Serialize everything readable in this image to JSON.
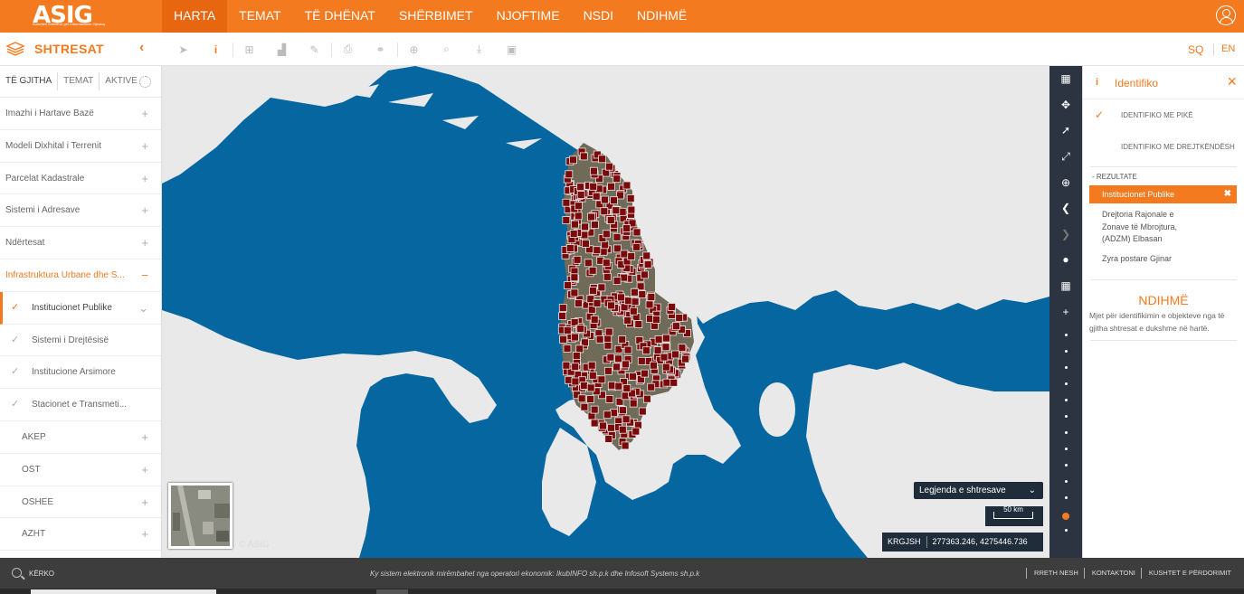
{
  "app": {
    "logo": "ASIG",
    "logo_subtitle": "Autoriteti Shtetëror për Informacionin Gjeohapësinor",
    "accent_color": "#f47a20",
    "nav": [
      "HARTA",
      "TEMAT",
      "TË DHËNAT",
      "SHËRBIMET",
      "NJOFTIME",
      "NSDI",
      "NDIHMË"
    ],
    "active_nav": "HARTA",
    "user_icon": "user-circle-icon"
  },
  "subbar": {
    "layers_title": "SHTRESAT",
    "collapse": "‹",
    "tools": [
      {
        "name": "select-pointer-icon",
        "glyph": "➤"
      },
      {
        "name": "identify-info-icon",
        "glyph": "i",
        "active": true
      },
      {
        "name": "zoom-box-icon",
        "glyph": "⊞"
      },
      {
        "name": "profile-chart-icon",
        "glyph": "▟"
      },
      {
        "name": "edit-icon",
        "glyph": "✎"
      },
      {
        "name": "print-icon",
        "glyph": "⎙"
      },
      {
        "name": "link-icon",
        "glyph": "⚭"
      },
      {
        "name": "add-icon",
        "glyph": "⊕"
      },
      {
        "name": "search-map-icon",
        "glyph": "⌕"
      },
      {
        "name": "download-icon",
        "glyph": "⤓"
      },
      {
        "name": "image-icon",
        "glyph": "▣"
      }
    ],
    "lang_sq": "SQ",
    "lang_en": "EN"
  },
  "sidebar": {
    "tabs": [
      "TË GJITHA",
      "TEMAT",
      "AKTIVE"
    ],
    "groups": [
      {
        "label": "Imazhi i Hartave Bazë",
        "toggle": "+"
      },
      {
        "label": "Modeli Dixhital i Terrenit",
        "toggle": "+"
      },
      {
        "label": "Parcelat Kadastrale",
        "toggle": "+"
      },
      {
        "label": "Sistemi i Adresave",
        "toggle": "+"
      },
      {
        "label": "Ndërtesat",
        "toggle": "+"
      },
      {
        "label": "Infrastruktura Urbane dhe S...",
        "toggle": "−"
      }
    ],
    "sublayers": [
      {
        "label": "Institucionet Publike",
        "toggle": "⌄"
      },
      {
        "label": "Sistemi i Drejtësisë"
      },
      {
        "label": "Institucione Arsimore"
      },
      {
        "label": "Stacionet e Transmeti..."
      }
    ],
    "children": [
      {
        "label": "AKEP",
        "toggle": "+"
      },
      {
        "label": "OST",
        "toggle": "+"
      },
      {
        "label": "OSHEE",
        "toggle": "+"
      },
      {
        "label": "AZHT",
        "toggle": "+"
      }
    ]
  },
  "map": {
    "copyright": "© ASIG",
    "legend_button": "Legjenda e shtresave",
    "scale_label": "50 km",
    "crs": "KRGJSH",
    "coordinates": "277363.246, 4275446.736",
    "land_color": "#e9e9e9",
    "sea_color": "#0566a0",
    "marker_color": "#7a0a0a",
    "strip_buttons": [
      {
        "name": "basemap-toggle-icon",
        "glyph": "▦"
      },
      {
        "name": "full-extent-icon",
        "glyph": "✥"
      },
      {
        "name": "locate-icon",
        "glyph": "➚"
      },
      {
        "name": "fullscreen-icon",
        "glyph": "⤢"
      },
      {
        "name": "zoom-search-icon",
        "glyph": "⊕"
      },
      {
        "name": "previous-extent-icon",
        "glyph": "❮"
      },
      {
        "name": "next-extent-icon",
        "glyph": "❯"
      },
      {
        "name": "globe-icon",
        "glyph": "●"
      },
      {
        "name": "grid-icon",
        "glyph": "▦"
      },
      {
        "name": "zoom-in-icon",
        "glyph": "+"
      }
    ]
  },
  "identify": {
    "title": "Identifiko",
    "options": [
      "IDENTIFIKO ME PIKË",
      "IDENTIFIKO ME DREJTKËNDËSH"
    ],
    "results_label": "REZULTATE",
    "selected_result": "Institucionet Publike",
    "results": [
      "Drejtoria Rajonale e Zonave të Mbrojtura, (ADZM) Elbasan",
      "Zyra postare Gjinar"
    ],
    "help_title": "NDIHMË",
    "help_text": "Mjet për identifikimin e objekteve nga të gjitha shtresat e dukshme në hartë."
  },
  "footer": {
    "search_label": "KËRKO",
    "message": "Ky sistem elektronik mirëmbahet nga operatori ekonomik: IkubINFO sh.p.k dhe Infosoft Systems sh.p.k",
    "links": [
      "RRETH NESH",
      "KONTAKTONI",
      "KUSHTET E PËRDORIMIT"
    ]
  }
}
